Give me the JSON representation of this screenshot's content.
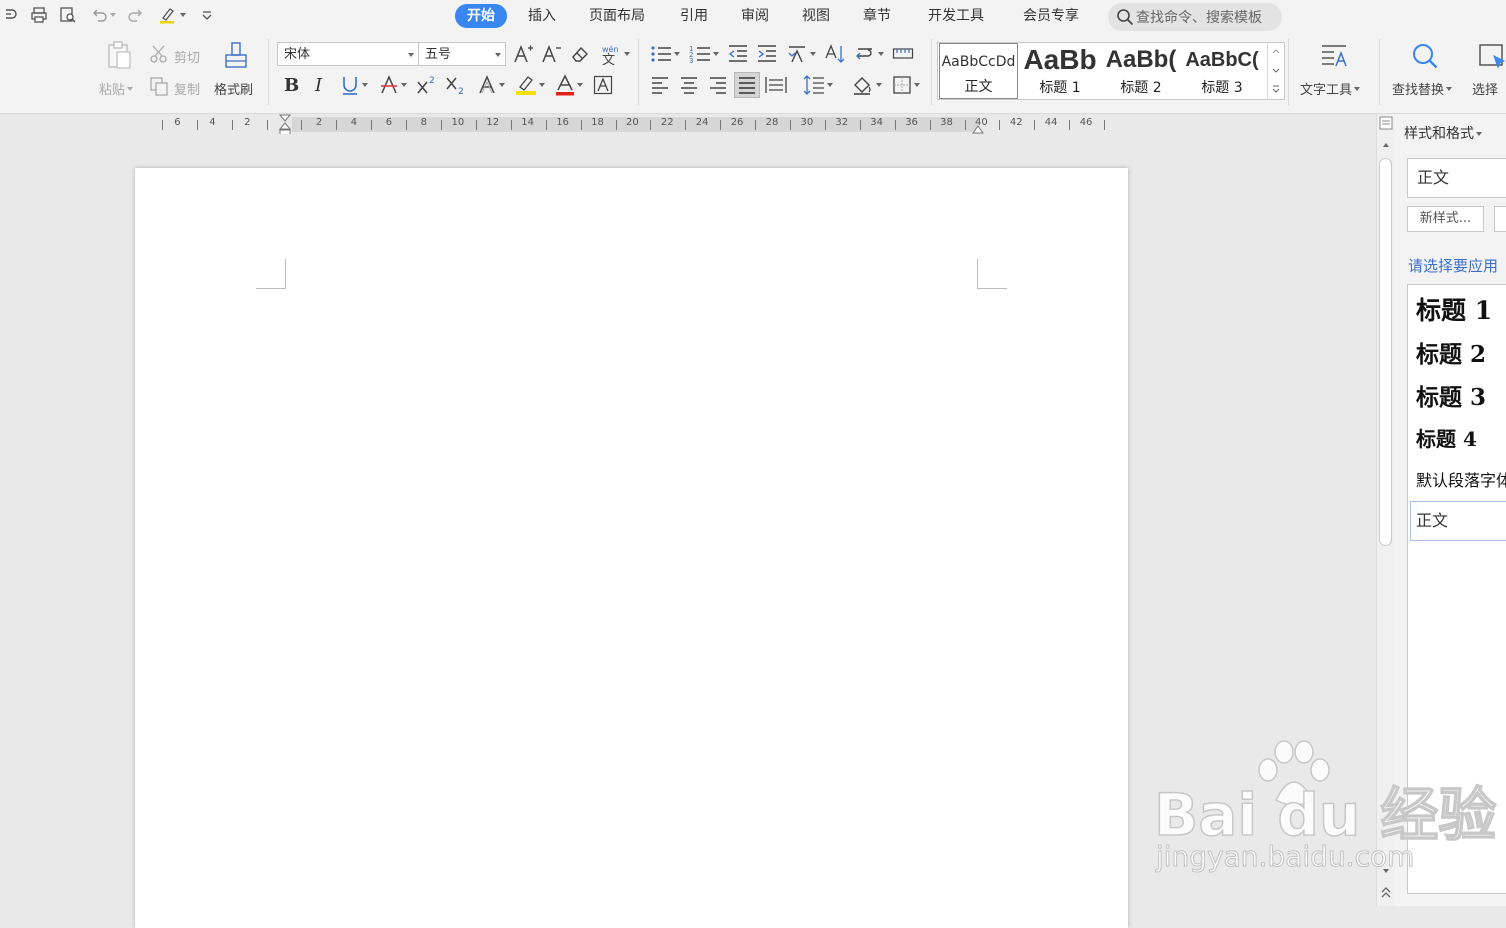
{
  "menu": {
    "tabs": [
      {
        "label": "开始",
        "active": true
      },
      {
        "label": "插入"
      },
      {
        "label": "页面布局"
      },
      {
        "label": "引用"
      },
      {
        "label": "审阅"
      },
      {
        "label": "视图"
      },
      {
        "label": "章节"
      },
      {
        "label": "开发工具"
      },
      {
        "label": "会员专享"
      }
    ],
    "search_placeholder": "查找命令、搜索模板",
    "accent_color": "#3a86f0"
  },
  "ribbon": {
    "paste_label": "粘贴",
    "cut_label": "剪切",
    "copy_label": "复制",
    "format_painter_label": "格式刷",
    "font_name": "宋体",
    "font_size": "五号",
    "styles": [
      {
        "preview": "AaBbCcDd",
        "name": "正文"
      },
      {
        "preview": "AaBb",
        "name": "标题 1"
      },
      {
        "preview": "AaBb(",
        "name": "标题 2"
      },
      {
        "preview": "AaBbC(",
        "name": "标题 3"
      }
    ],
    "text_tools_label": "文字工具",
    "find_replace_label": "查找替换",
    "select_label": "选择"
  },
  "ruler": {
    "left_numbers": [
      "6",
      "4",
      "2"
    ],
    "numbers": [
      "2",
      "4",
      "6",
      "8",
      "10",
      "12",
      "14",
      "16",
      "18",
      "20",
      "22",
      "24",
      "26",
      "28",
      "30",
      "32",
      "34",
      "36",
      "38",
      "40",
      "42",
      "44",
      "46"
    ]
  },
  "pane": {
    "title": "样式和格式",
    "current_style": "正文",
    "new_style_button": "新样式...",
    "prompt": "请选择要应用",
    "style_list": [
      {
        "label": "标题  1"
      },
      {
        "label": "标题  2"
      },
      {
        "label": "标题  3"
      },
      {
        "label": "标题  4"
      },
      {
        "label": "默认段落字体"
      },
      {
        "label": "正文"
      }
    ]
  },
  "watermark": {
    "line1": "Bai du 经验",
    "line2": "jingyan.baidu.com"
  }
}
